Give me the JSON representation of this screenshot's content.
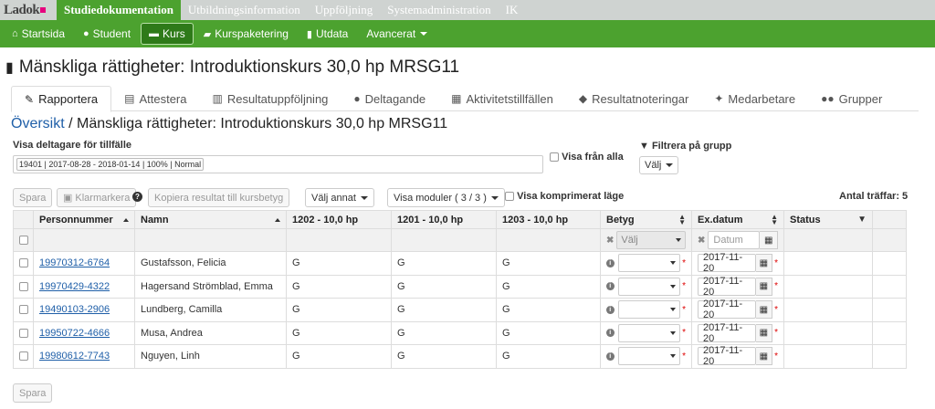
{
  "topbar": {
    "logo": "Ladok",
    "items": [
      "Studiedokumentation",
      "Utbildningsinformation",
      "Uppföljning",
      "Systemadministration",
      "IK"
    ]
  },
  "greenbar": {
    "items": [
      "Startsida",
      "Student",
      "Kurs",
      "Kurspaketering",
      "Utdata",
      "Avancerat"
    ]
  },
  "page_title": "Mänskliga rättigheter: Introduktionskurs 30,0 hp MRSG11",
  "tabs": [
    "Rapportera",
    "Attestera",
    "Resultatuppföljning",
    "Deltagande",
    "Aktivitetstillfällen",
    "Resultatnoteringar",
    "Medarbetare",
    "Grupper"
  ],
  "breadcrumb": {
    "link": "Översikt",
    "separator": " / ",
    "current": "Mänskliga rättigheter: Introduktionskurs 30,0 hp MRSG11"
  },
  "filters": {
    "visa_label": "Visa deltagare för tillfälle",
    "tillfalle_chip": "19401 | 2017-08-28 - 2018-01-14 | 100% | Normal",
    "visa_fran_alla": "Visa från alla",
    "filtrera_label": "Filtrera på grupp",
    "valj": "Välj"
  },
  "toolbar": {
    "spara": "Spara",
    "klarmarkera": "Klarmarkera",
    "kopiera": "Kopiera resultat till kursbetyg",
    "valj_annat": "Välj annat",
    "visa_moduler": "Visa moduler ( 3 / 3 )",
    "komprimerat": "Visa komprimerat läge",
    "antal": "Antal träffar: 5"
  },
  "table": {
    "headers": [
      "Personnummer",
      "Namn",
      "1202 - 10,0 hp",
      "1201 - 10,0 hp",
      "1203 - 10,0 hp",
      "Betyg",
      "Ex.datum",
      "Status"
    ],
    "betyg_placeholder": "Välj",
    "datum_placeholder": "Datum",
    "rows": [
      {
        "pn": "19970312-6764",
        "name": "Gustafsson, Felicia",
        "m1": "G",
        "m2": "G",
        "m3": "G",
        "date": "2017-11-20"
      },
      {
        "pn": "19970429-4322",
        "name": "Hagersand Strömblad, Emma",
        "m1": "G",
        "m2": "G",
        "m3": "G",
        "date": "2017-11-20"
      },
      {
        "pn": "19490103-2906",
        "name": "Lundberg, Camilla",
        "m1": "G",
        "m2": "G",
        "m3": "G",
        "date": "2017-11-20"
      },
      {
        "pn": "19950722-4666",
        "name": "Musa, Andrea",
        "m1": "G",
        "m2": "G",
        "m3": "G",
        "date": "2017-11-20"
      },
      {
        "pn": "19980612-7743",
        "name": "Nguyen, Linh",
        "m1": "G",
        "m2": "G",
        "m3": "G",
        "date": "2017-11-20"
      }
    ]
  },
  "footer": {
    "spara": "Spara"
  }
}
